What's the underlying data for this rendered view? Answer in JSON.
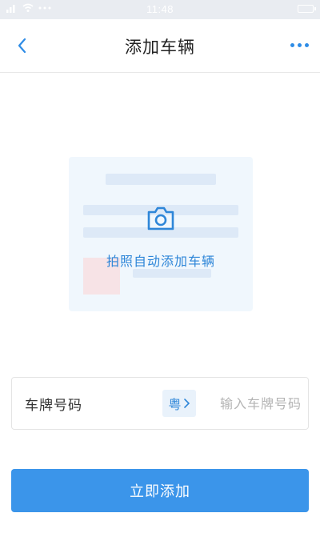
{
  "status_bar": {
    "time": "11:48",
    "icons": [
      "signal-icon",
      "wifi-icon",
      "more-dots-icon",
      "battery-icon"
    ]
  },
  "header": {
    "title": "添加车辆",
    "back_icon": "chevron-left-icon",
    "more_icon": "more-dots-icon"
  },
  "photo_card": {
    "label": "拍照自动添加车辆",
    "icon": "camera-icon"
  },
  "plate": {
    "label": "车牌号码",
    "province": "粤",
    "province_icon": "chevron-right-icon",
    "input_value": "",
    "placeholder": "输入车牌号码"
  },
  "submit": {
    "label": "立即添加"
  },
  "colors": {
    "accent": "#3b95ea",
    "link": "#2e86d8",
    "card_bg": "#f0f7fd"
  }
}
